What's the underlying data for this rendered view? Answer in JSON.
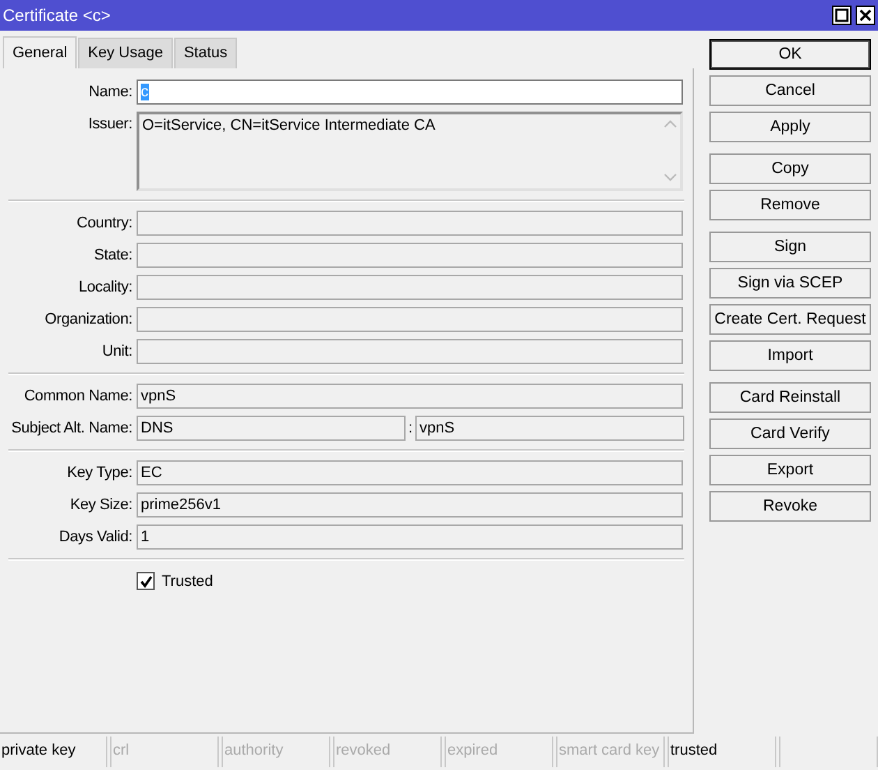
{
  "window": {
    "title": "Certificate <c>"
  },
  "tabs": [
    {
      "label": "General",
      "selected": true
    },
    {
      "label": "Key Usage",
      "selected": false
    },
    {
      "label": "Status",
      "selected": false
    }
  ],
  "sections": [
    {
      "rows": [
        {
          "kind": "text",
          "label": "Name:",
          "value": "c",
          "editable": true,
          "text_selected": true
        },
        {
          "kind": "textarea",
          "label": "Issuer:",
          "value": "O=itService, CN=itService Intermediate CA",
          "editable": false
        }
      ]
    },
    {
      "rows": [
        {
          "kind": "text",
          "label": "Country:",
          "editable": false
        },
        {
          "kind": "text",
          "label": "State:",
          "editable": false
        },
        {
          "kind": "text",
          "label": "Locality:",
          "editable": false
        },
        {
          "kind": "text",
          "label": "Organization:",
          "editable": false
        },
        {
          "kind": "text",
          "label": "Unit:",
          "editable": false
        }
      ]
    },
    {
      "rows": [
        {
          "kind": "text",
          "label": "Common Name:",
          "value": "vpnS",
          "editable": false
        },
        {
          "kind": "pair",
          "label": "Subject Alt. Name:",
          "value": "DNS",
          "separator": ":",
          "value_2": "vpnS",
          "editable": false
        }
      ]
    },
    {
      "rows": [
        {
          "kind": "text",
          "label": "Key Type:",
          "value": "EC",
          "editable": false
        },
        {
          "kind": "text",
          "label": "Key Size:",
          "value": "prime256v1",
          "editable": false
        },
        {
          "kind": "text",
          "label": "Days Valid:",
          "value": "1",
          "editable": false
        }
      ]
    },
    {
      "rows": [
        {
          "kind": "checkbox",
          "label": "Trusted",
          "checked": true
        }
      ]
    }
  ],
  "button_groups": [
    [
      {
        "label": "OK",
        "default": true
      },
      {
        "label": "Cancel",
        "default": false
      },
      {
        "label": "Apply",
        "default": false
      }
    ],
    [
      {
        "label": "Copy",
        "default": false
      },
      {
        "label": "Remove",
        "default": false
      }
    ],
    [
      {
        "label": "Sign",
        "default": false
      },
      {
        "label": "Sign via SCEP",
        "default": false
      },
      {
        "label": "Create Cert. Request",
        "default": false
      },
      {
        "label": "Import",
        "default": false
      }
    ],
    [
      {
        "label": "Card Reinstall",
        "default": false
      },
      {
        "label": "Card Verify",
        "default": false
      },
      {
        "label": "Export",
        "default": false
      },
      {
        "label": "Revoke",
        "default": false
      }
    ]
  ],
  "status_bar": [
    {
      "label": "private key",
      "on": true
    },
    {
      "label": "crl",
      "on": false
    },
    {
      "label": "authority",
      "on": false
    },
    {
      "label": "revoked",
      "on": false
    },
    {
      "label": "expired",
      "on": false
    },
    {
      "label": "smart card key",
      "on": false
    },
    {
      "label": "trusted",
      "on": true
    }
  ]
}
